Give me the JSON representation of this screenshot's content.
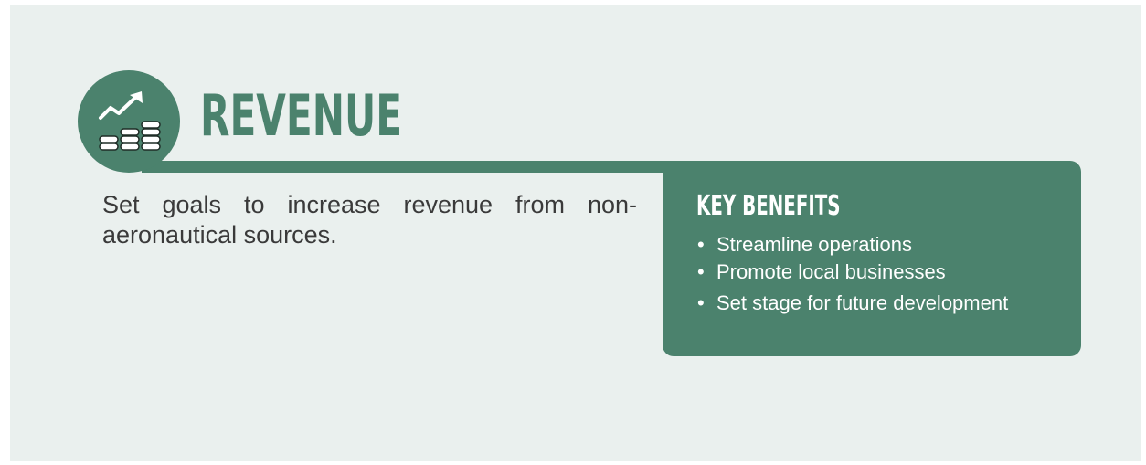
{
  "header": {
    "icon": "revenue-growth-coins-icon",
    "title": "REVENUE"
  },
  "description": "Set goals to increase revenue from non-aeronautical sources.",
  "benefits": {
    "title": "KEY BENEFITS",
    "items": [
      "Streamline operations",
      "Promote local businesses",
      "Set stage for future development"
    ]
  },
  "colors": {
    "accent": "#4b826d",
    "background": "#eaf0ee",
    "text": "#3a3a3a"
  }
}
